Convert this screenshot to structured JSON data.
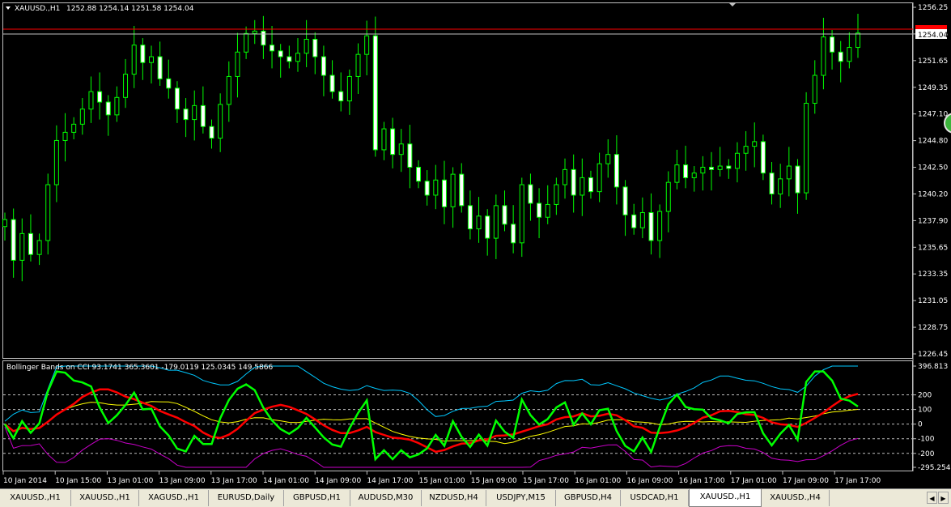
{
  "main_chart": {
    "header_symbol": "XAUUSD.,H1",
    "header_ohlc": "1252.88 1254.14 1251.58 1254.04",
    "price_labels": [
      "1256.25",
      "1253.95",
      "1251.65",
      "1249.35",
      "1247.10",
      "1244.80",
      "1242.50",
      "1240.20",
      "1237.90",
      "1235.65",
      "1233.35",
      "1231.05",
      "1228.75",
      "1226.45"
    ],
    "current_price_label": "1254.04",
    "colors": {
      "bull": "#000000",
      "bear": "#ffffff",
      "wick": "#00ff00",
      "ask_line": "#ff0000",
      "bid_line": "#c0c0c0"
    }
  },
  "indicator": {
    "title": "Bollinger Bands on CCI 93.1741 365.3601 -179.0119 125.0345 149.5866",
    "scale_labels": [
      "396.813",
      "200",
      "100",
      "0",
      "-100",
      "-200",
      "-295.2547"
    ],
    "colors": {
      "cci": "#00ff00",
      "middle": "#ff0000",
      "ma": "#ffff00",
      "upper": "#00c8ff",
      "lower": "#c800c8"
    }
  },
  "time_labels": [
    "10 Jan 2014",
    "10 Jan 15:00",
    "13 Jan 01:00",
    "13 Jan 09:00",
    "13 Jan 17:00",
    "14 Jan 01:00",
    "14 Jan 09:00",
    "14 Jan 17:00",
    "15 Jan 01:00",
    "15 Jan 09:00",
    "15 Jan 17:00",
    "16 Jan 01:00",
    "16 Jan 09:00",
    "16 Jan 17:00",
    "17 Jan 01:00",
    "17 Jan 09:00",
    "17 Jan 17:00"
  ],
  "tabs": [
    {
      "label": "XAUUSD.,H1"
    },
    {
      "label": "XAUUSD.,H1"
    },
    {
      "label": "XAGUSD.,H1"
    },
    {
      "label": "EURUSD,Daily"
    },
    {
      "label": "GBPUSD,H1"
    },
    {
      "label": "AUDUSD,M30"
    },
    {
      "label": "NZDUSD,H4"
    },
    {
      "label": "USDJPY,M15"
    },
    {
      "label": "GBPUSD,H4"
    },
    {
      "label": "USDCAD,H1"
    },
    {
      "label": "XAUUSD.,H1",
      "active": true
    },
    {
      "label": "XAUUSD.,H4"
    }
  ],
  "chart_data": {
    "type": "candlestick",
    "price_range": [
      1226.45,
      1256.25
    ],
    "closes": [
      1238.0,
      1234.5,
      1236.8,
      1235.0,
      1236.2,
      1241.0,
      1244.8,
      1245.5,
      1246.2,
      1247.5,
      1249.0,
      1248.1,
      1247.0,
      1248.5,
      1250.5,
      1253.0,
      1251.5,
      1252.0,
      1250.1,
      1249.3,
      1247.5,
      1246.6,
      1247.8,
      1246.0,
      1245.0,
      1247.9,
      1250.3,
      1252.4,
      1254.0,
      1254.2,
      1253.0,
      1252.5,
      1252.0,
      1251.6,
      1252.3,
      1253.5,
      1252.0,
      1250.4,
      1249.0,
      1248.2,
      1250.3,
      1252.2,
      1253.8,
      1244.0,
      1245.8,
      1243.6,
      1244.5,
      1242.5,
      1241.3,
      1240.1,
      1241.4,
      1239.1,
      1241.9,
      1239.2,
      1237.2,
      1238.3,
      1236.4,
      1239.2,
      1237.6,
      1236.0,
      1241.0,
      1239.4,
      1238.2,
      1239.3,
      1241.0,
      1242.3,
      1240.1,
      1241.6,
      1240.4,
      1242.8,
      1243.6,
      1240.8,
      1238.4,
      1237.3,
      1238.6,
      1236.2,
      1238.7,
      1241.2,
      1242.7,
      1241.6,
      1242.0,
      1242.5,
      1242.3,
      1242.6,
      1242.4,
      1243.7,
      1244.3,
      1244.7,
      1242.0,
      1240.2,
      1241.5,
      1242.6,
      1240.3,
      1248.0,
      1250.4,
      1253.7,
      1252.4,
      1251.6,
      1252.8,
      1254.04
    ],
    "opens_start": 1237.4
  }
}
